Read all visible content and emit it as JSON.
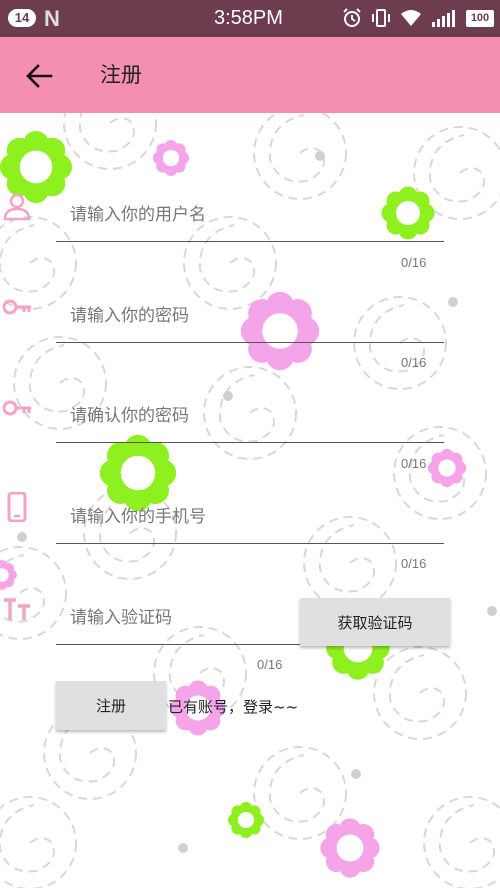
{
  "status_bar": {
    "notification_count": "14",
    "carrier_logo": "N",
    "time": "3:58PM",
    "battery": "100",
    "icons": [
      "alarm-icon",
      "vibrate-icon",
      "wifi-icon",
      "signal-icon",
      "battery-icon"
    ]
  },
  "app_bar": {
    "title": "注册",
    "back_icon": "arrow-left-icon"
  },
  "form": {
    "username": {
      "placeholder": "请输入你的用户名",
      "counter": "0/16",
      "icon": "person-icon"
    },
    "password": {
      "placeholder": "请输入你的密码",
      "counter": "0/16",
      "icon": "key-icon"
    },
    "confirm_password": {
      "placeholder": "请确认你的密码",
      "counter": "0/16",
      "icon": "key-icon"
    },
    "phone": {
      "placeholder": "请输入你的手机号",
      "counter": "0/16",
      "icon": "phone-icon"
    },
    "code": {
      "placeholder": "请输入验证码",
      "counter": "0/16",
      "icon": "text-size-icon"
    },
    "get_code_label": "获取验证码",
    "register_label": "注册",
    "login_link": "已有账号，登录~~"
  },
  "colors": {
    "status_bar": "#6d3c4f",
    "app_bar": "#f48fb1",
    "icon_pink": "#f3a3c4",
    "flower_green": "#8ef01f",
    "flower_pink": "#f6a4ea"
  }
}
